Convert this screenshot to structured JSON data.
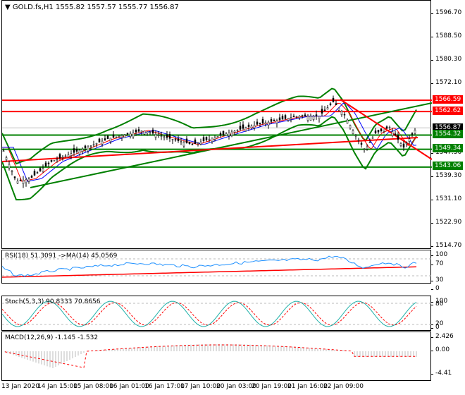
{
  "header": {
    "symbol_label": "GOLD.fs,H1",
    "ohlc": "1555.82 1557.57 1555.77 1556.87"
  },
  "price_axis": [
    "1596.70",
    "1588.50",
    "1580.30",
    "1572.10",
    "1547.50",
    "1539.30",
    "1531.10",
    "1522.90",
    "1514.70"
  ],
  "price_labels": [
    {
      "value": "1566.59",
      "color": "#ff0000"
    },
    {
      "value": "1562.62",
      "color": "#ff0000"
    },
    {
      "value": "1556.87",
      "color": "#000000"
    },
    {
      "value": "1554.32",
      "color": "#008000"
    },
    {
      "value": "1549.34",
      "color": "#008000"
    },
    {
      "value": "1543.06",
      "color": "#008000"
    }
  ],
  "rsi": {
    "label": "RSI(18) 51.3091  ->MA(14) 45.0569",
    "axis": [
      "100",
      "70",
      "30",
      "0"
    ]
  },
  "stoch": {
    "label": "Stoch(5,3,3) 90.8333 70.8656",
    "axis": [
      "100",
      "80",
      "20",
      "0"
    ]
  },
  "macd": {
    "label": "MACD(12,26,9) -1.145 -1.532",
    "axis": [
      "2.426",
      "0.00",
      "-4.41"
    ]
  },
  "time_axis": [
    "13 Jan 2020",
    "14 Jan 15:00",
    "15 Jan 08:00",
    "16 Jan 01:00",
    "16 Jan 17:00",
    "17 Jan 10:00",
    "20 Jan 03:00",
    "20 Jan 19:00",
    "21 Jan 16:00",
    "22 Jan 09:00"
  ],
  "colors": {
    "support": "#008000",
    "resistance": "#ff0000",
    "rsi": "#1e90ff",
    "stoch": "#20b2aa"
  }
}
